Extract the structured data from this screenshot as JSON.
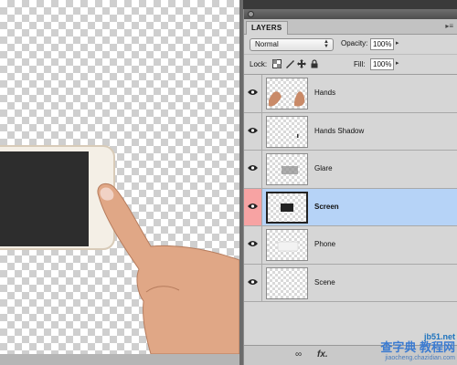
{
  "panel": {
    "tab_label": "LAYERS",
    "menu_icon": "panel-menu-icon",
    "blend_mode": "Normal",
    "opacity_label": "Opacity:",
    "opacity_value": "100%",
    "lock_label": "Lock:",
    "fill_label": "Fill:",
    "fill_value": "100%"
  },
  "layers": [
    {
      "name": "Hands",
      "visible": true,
      "selected": false
    },
    {
      "name": "Hands Shadow",
      "visible": true,
      "selected": false
    },
    {
      "name": "Glare",
      "visible": true,
      "selected": false
    },
    {
      "name": "Screen",
      "visible": true,
      "selected": true
    },
    {
      "name": "Phone",
      "visible": true,
      "selected": false
    },
    {
      "name": "Scene",
      "visible": true,
      "selected": false
    }
  ],
  "bottom_bar": {
    "link_icon": "link-icon",
    "fx_label": "fx."
  },
  "watermark": {
    "domain": "jb51.net",
    "chinese": "查字典 教程网",
    "sub": "jiaocheng.chazidian.com"
  },
  "colors": {
    "selected_row": "#b6d3f7",
    "selected_eye_cell": "#f7a3a3",
    "panel_bg": "#d6d6d6"
  }
}
